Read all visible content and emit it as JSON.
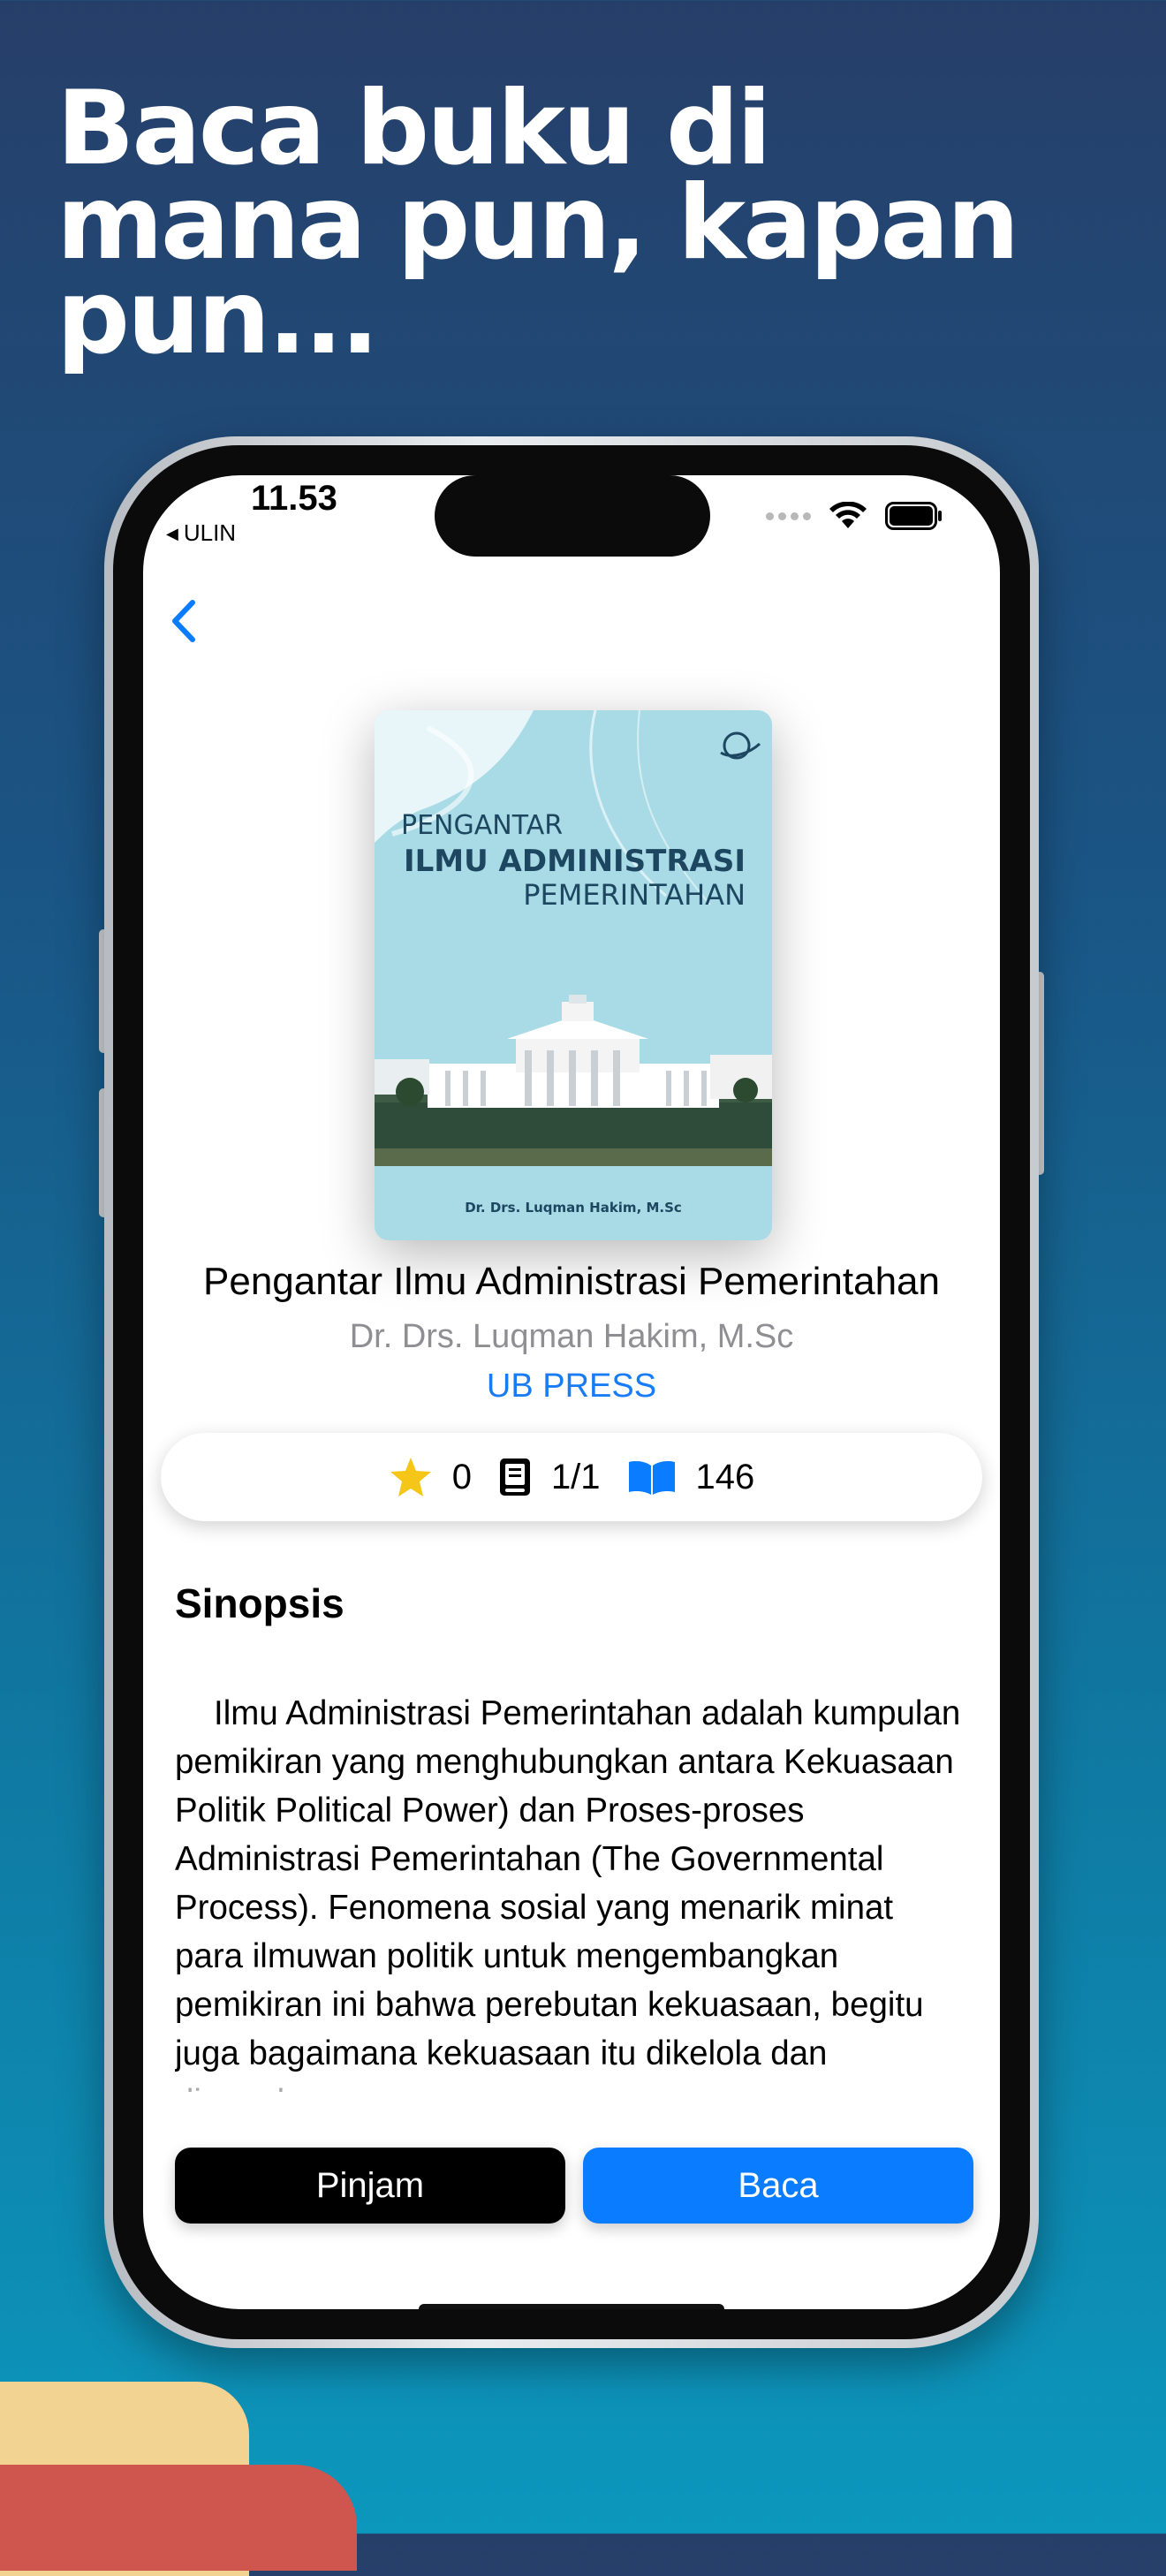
{
  "headline": [
    "Baca buku di",
    "mana pun, kapan",
    "pun..."
  ],
  "status_bar": {
    "time": "11.53",
    "back_app": "ULIN"
  },
  "book": {
    "title": "Pengantar Ilmu Administrasi Pemerintahan",
    "author": "Dr. Drs. Luqman Hakim, M.Sc",
    "publisher": "UB PRESS",
    "cover": {
      "line1": "PENGANTAR",
      "line2": "ILMU ADMINISTRASI",
      "line3": "PEMERINTAHAN",
      "author": "Dr. Drs. Luqman Hakim, M.Sc",
      "colors": {
        "sky": "#a9dbe6",
        "accent": "#1d4660"
      }
    }
  },
  "stats": {
    "rating": "0",
    "copies": "1/1",
    "reads": "146"
  },
  "synopsis": {
    "heading": "Sinopsis",
    "text": "Ilmu Administrasi Pemerintahan adalah kumpulan pemikiran yang menghubungkan antara Kekuasaan Politik Political Power) dan Proses-proses Administrasi Pemerintahan (The Governmental Process). Fenomena sosial yang menarik minat para ilmuwan politik untuk mengembangkan pemikiran ini bahwa perebutan kekuasaan, begitu juga bagaimana kekuasaan itu dikelola dan digunakan..."
  },
  "actions": {
    "borrow": "Pinjam",
    "read": "Baca"
  },
  "colors": {
    "accent": "#0a7cff",
    "star": "#f5c518",
    "deco_yellow": "#f2d392",
    "deco_red": "#cf564f"
  },
  "icons": [
    "back-chevron-icon",
    "star-icon",
    "book-icon",
    "open-book-icon",
    "wifi-icon",
    "battery-icon",
    "signal-icon"
  ]
}
